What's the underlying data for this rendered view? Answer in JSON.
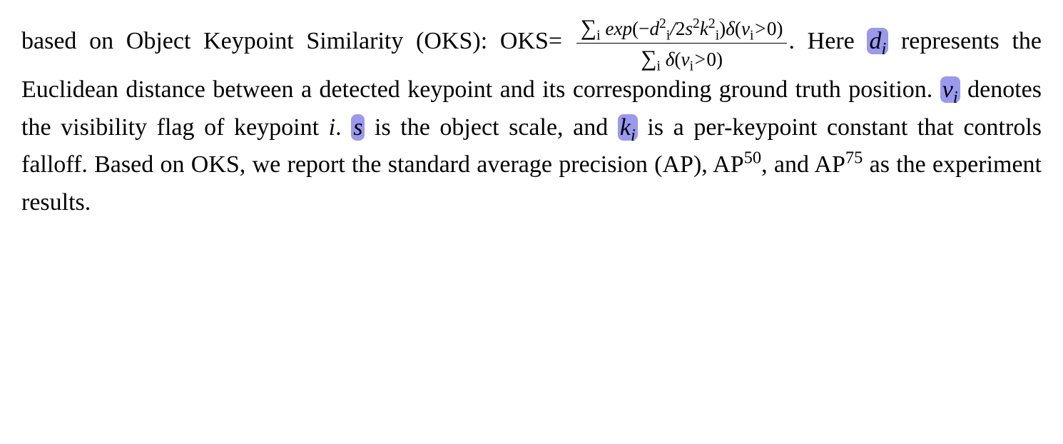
{
  "text": {
    "t1": "based on Object Keypoint Similarity (OKS): OKS",
    "eq": "=",
    "num_sum": "∑",
    "num_sub": "i",
    "num_exp": "exp",
    "num_lp": "(−",
    "num_d": "d",
    "num_sq1": "2",
    "num_i1": "i",
    "num_slash": "/",
    "num_2": "2",
    "num_s": "s",
    "num_sq2": "2",
    "num_k": "k",
    "num_sq3": "2",
    "num_i2": "i",
    "num_rp": ")",
    "num_delta": "δ",
    "num_lp2": "(",
    "num_v": "v",
    "num_i3": "i",
    "num_gt": ">",
    "num_zero": "0)",
    "den_sum": "∑",
    "den_sub": "i",
    "den_delta": "δ",
    "den_lp": "(",
    "den_v": "v",
    "den_i": "i",
    "den_gt": ">",
    "den_zero": "0)",
    "t2": ". Here ",
    "di_d": "d",
    "di_i": "i",
    "t3": " represents the Euclidean distance between a detected keypoint and its corresponding ground truth position. ",
    "vi_v": "v",
    "vi_i": "i",
    "t4": " denotes the visibility flag of key­point ",
    "i1": "i",
    "t5": ". ",
    "s": "s",
    "t6": " is the object scale, and ",
    "ki_k": "k",
    "ki_i": "i",
    "t7": " is a per-keypoint constant that controls falloff. Based on OKS, we report the standard average precision (AP), AP",
    "sup50": "50",
    "t8": ", and AP",
    "sup75": "75",
    "t9": " as the experiment results."
  }
}
